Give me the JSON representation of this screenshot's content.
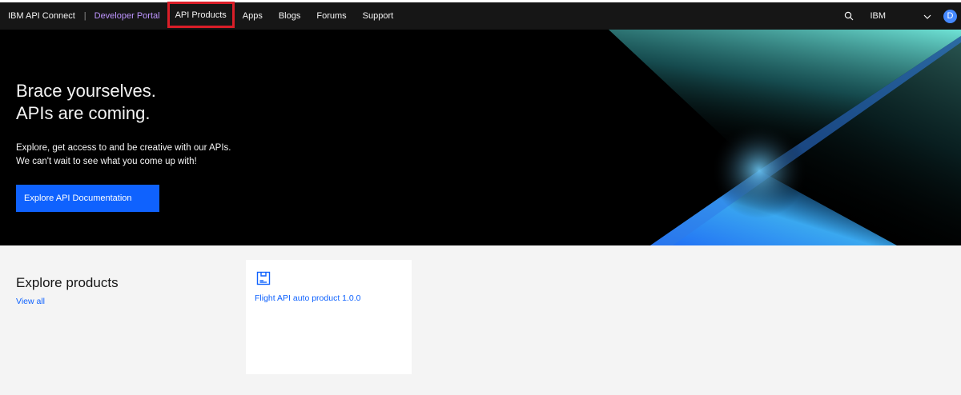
{
  "header": {
    "brand": "IBM API Connect",
    "separator": "|",
    "portal": "Developer Portal",
    "nav": [
      {
        "label": "API Products"
      },
      {
        "label": "Apps"
      },
      {
        "label": "Blogs"
      },
      {
        "label": "Forums"
      },
      {
        "label": "Support"
      }
    ],
    "org": "IBM",
    "avatar_initial": "D",
    "icons": {
      "search": "search-icon",
      "chevron": "chevron-down-icon"
    }
  },
  "hero": {
    "title_line1": "Brace yourselves.",
    "title_line2": "APIs are coming.",
    "subtitle_line1": "Explore, get access to and be creative with our APIs.",
    "subtitle_line2": "We can't wait to see what you come up with!",
    "cta": "Explore API Documentation"
  },
  "products": {
    "title": "Explore products",
    "view_all": "View all",
    "cards": [
      {
        "name": "Flight API auto product 1.0.0",
        "icon": "product-box-icon"
      }
    ]
  },
  "colors": {
    "accent": "#0f62fe",
    "portal_text": "#be95ff",
    "highlight_border": "#da1e28",
    "avatar": "#4589ff",
    "hero_gradient_teal": "#6fe3d6",
    "hero_gradient_blue": "#1f6cf5"
  }
}
